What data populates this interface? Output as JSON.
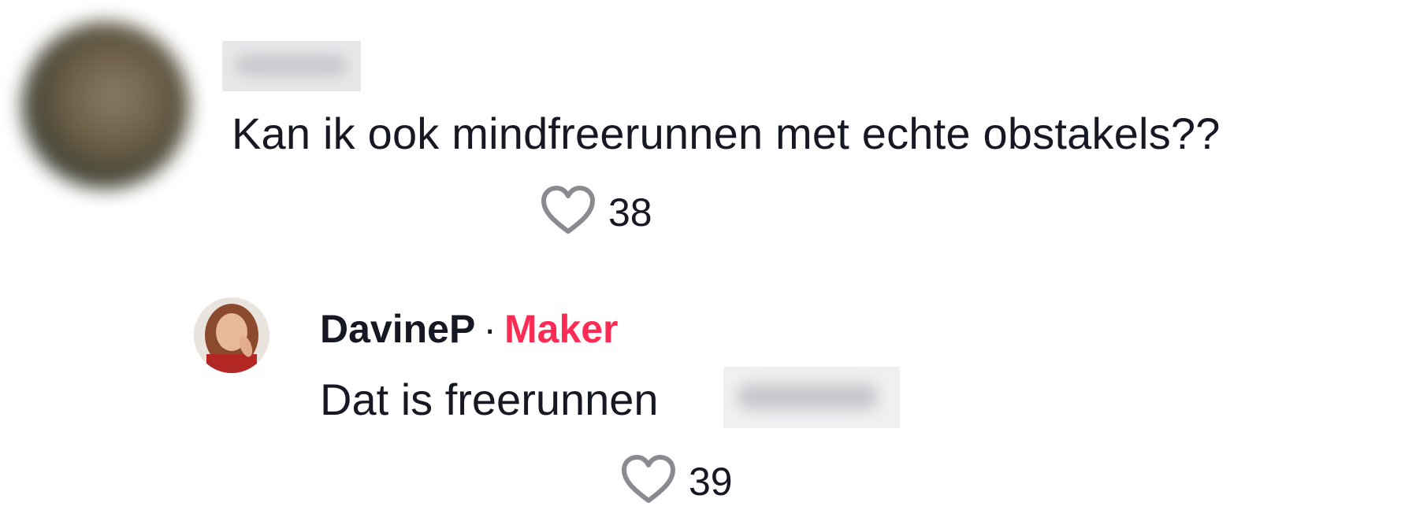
{
  "comment": {
    "text": "Kan ik ook mindfreerunnen met echte obstakels??",
    "like_count": "38",
    "like_icon": "heart-outline-icon"
  },
  "reply": {
    "username": "DavineP",
    "separator": "·",
    "creator_badge": "Maker",
    "text": "Dat is freerunnen",
    "like_count": "39",
    "like_icon": "heart-outline-icon"
  },
  "colors": {
    "text": "#161823",
    "creator_badge": "#fe2c55",
    "icon": "#8a8b91"
  }
}
